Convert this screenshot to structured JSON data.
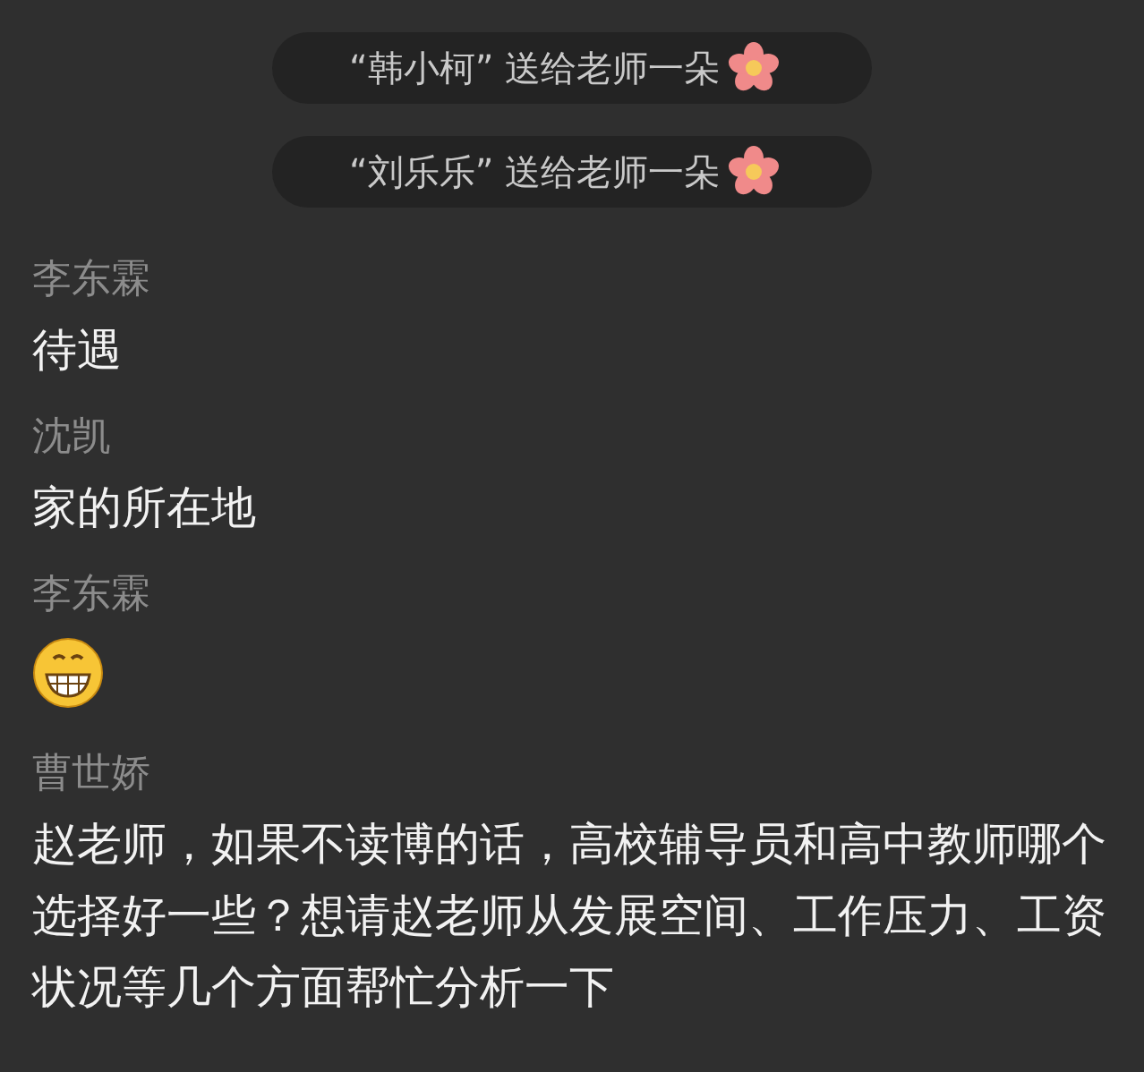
{
  "gift_notices": [
    {
      "text": "“韩小柯” 送给老师一朵"
    },
    {
      "text": "“刘乐乐” 送给老师一朵"
    }
  ],
  "messages": [
    {
      "sender": "李东霖",
      "kind": "text",
      "text": "待遇"
    },
    {
      "sender": "沈凯",
      "kind": "text",
      "text": "家的所在地"
    },
    {
      "sender": "李东霖",
      "kind": "emoji"
    },
    {
      "sender": "曹世娇",
      "kind": "text",
      "text": "赵老师，如果不读博的话，高校辅导员和高中教师哪个选择好一些？想请赵老师从发展空间、工作压力、工资状况等几个方面帮忙分析一下"
    }
  ]
}
